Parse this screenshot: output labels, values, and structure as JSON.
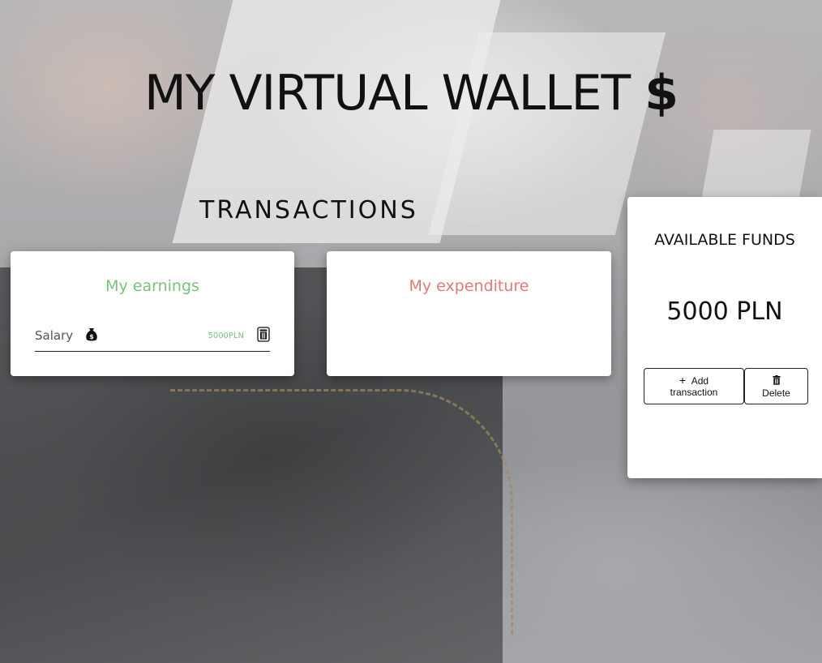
{
  "header": {
    "title": "MY VIRTUAL WALLET",
    "title_icon": "dollar-icon",
    "title_icon_glyph": "$"
  },
  "transactions": {
    "section_title": "TRANSACTIONS",
    "earnings": {
      "heading": "My earnings",
      "color": "#7cc27a",
      "items": [
        {
          "name": "Salary",
          "category_icon": "money-bag-icon",
          "amount": "5000PLN",
          "delete_icon": "trash-icon"
        }
      ]
    },
    "expenditure": {
      "heading": "My expenditure",
      "color": "#e07b78",
      "items": []
    }
  },
  "funds": {
    "label": "AVAILABLE FUNDS",
    "value": "5000 PLN",
    "add_button": {
      "icon": "plus-icon",
      "icon_glyph": "+",
      "label_line1": "Add",
      "label_line2": "transaction"
    },
    "delete_button": {
      "icon": "trash-icon",
      "label": "Delete"
    }
  }
}
